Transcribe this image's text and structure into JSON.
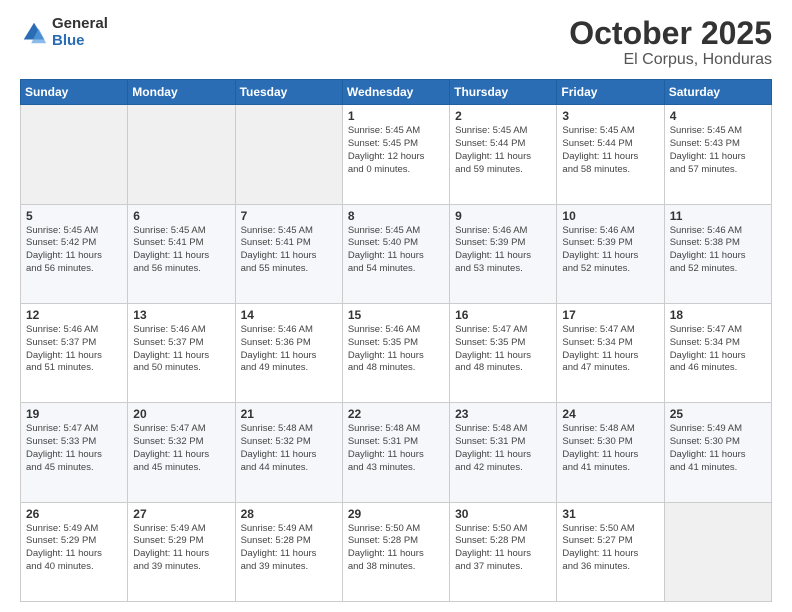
{
  "logo": {
    "general": "General",
    "blue": "Blue"
  },
  "title": "October 2025",
  "subtitle": "El Corpus, Honduras",
  "days_header": [
    "Sunday",
    "Monday",
    "Tuesday",
    "Wednesday",
    "Thursday",
    "Friday",
    "Saturday"
  ],
  "weeks": [
    [
      {
        "day": "",
        "info": ""
      },
      {
        "day": "",
        "info": ""
      },
      {
        "day": "",
        "info": ""
      },
      {
        "day": "1",
        "info": "Sunrise: 5:45 AM\nSunset: 5:45 PM\nDaylight: 12 hours\nand 0 minutes."
      },
      {
        "day": "2",
        "info": "Sunrise: 5:45 AM\nSunset: 5:44 PM\nDaylight: 11 hours\nand 59 minutes."
      },
      {
        "day": "3",
        "info": "Sunrise: 5:45 AM\nSunset: 5:44 PM\nDaylight: 11 hours\nand 58 minutes."
      },
      {
        "day": "4",
        "info": "Sunrise: 5:45 AM\nSunset: 5:43 PM\nDaylight: 11 hours\nand 57 minutes."
      }
    ],
    [
      {
        "day": "5",
        "info": "Sunrise: 5:45 AM\nSunset: 5:42 PM\nDaylight: 11 hours\nand 56 minutes."
      },
      {
        "day": "6",
        "info": "Sunrise: 5:45 AM\nSunset: 5:41 PM\nDaylight: 11 hours\nand 56 minutes."
      },
      {
        "day": "7",
        "info": "Sunrise: 5:45 AM\nSunset: 5:41 PM\nDaylight: 11 hours\nand 55 minutes."
      },
      {
        "day": "8",
        "info": "Sunrise: 5:45 AM\nSunset: 5:40 PM\nDaylight: 11 hours\nand 54 minutes."
      },
      {
        "day": "9",
        "info": "Sunrise: 5:46 AM\nSunset: 5:39 PM\nDaylight: 11 hours\nand 53 minutes."
      },
      {
        "day": "10",
        "info": "Sunrise: 5:46 AM\nSunset: 5:39 PM\nDaylight: 11 hours\nand 52 minutes."
      },
      {
        "day": "11",
        "info": "Sunrise: 5:46 AM\nSunset: 5:38 PM\nDaylight: 11 hours\nand 52 minutes."
      }
    ],
    [
      {
        "day": "12",
        "info": "Sunrise: 5:46 AM\nSunset: 5:37 PM\nDaylight: 11 hours\nand 51 minutes."
      },
      {
        "day": "13",
        "info": "Sunrise: 5:46 AM\nSunset: 5:37 PM\nDaylight: 11 hours\nand 50 minutes."
      },
      {
        "day": "14",
        "info": "Sunrise: 5:46 AM\nSunset: 5:36 PM\nDaylight: 11 hours\nand 49 minutes."
      },
      {
        "day": "15",
        "info": "Sunrise: 5:46 AM\nSunset: 5:35 PM\nDaylight: 11 hours\nand 48 minutes."
      },
      {
        "day": "16",
        "info": "Sunrise: 5:47 AM\nSunset: 5:35 PM\nDaylight: 11 hours\nand 48 minutes."
      },
      {
        "day": "17",
        "info": "Sunrise: 5:47 AM\nSunset: 5:34 PM\nDaylight: 11 hours\nand 47 minutes."
      },
      {
        "day": "18",
        "info": "Sunrise: 5:47 AM\nSunset: 5:34 PM\nDaylight: 11 hours\nand 46 minutes."
      }
    ],
    [
      {
        "day": "19",
        "info": "Sunrise: 5:47 AM\nSunset: 5:33 PM\nDaylight: 11 hours\nand 45 minutes."
      },
      {
        "day": "20",
        "info": "Sunrise: 5:47 AM\nSunset: 5:32 PM\nDaylight: 11 hours\nand 45 minutes."
      },
      {
        "day": "21",
        "info": "Sunrise: 5:48 AM\nSunset: 5:32 PM\nDaylight: 11 hours\nand 44 minutes."
      },
      {
        "day": "22",
        "info": "Sunrise: 5:48 AM\nSunset: 5:31 PM\nDaylight: 11 hours\nand 43 minutes."
      },
      {
        "day": "23",
        "info": "Sunrise: 5:48 AM\nSunset: 5:31 PM\nDaylight: 11 hours\nand 42 minutes."
      },
      {
        "day": "24",
        "info": "Sunrise: 5:48 AM\nSunset: 5:30 PM\nDaylight: 11 hours\nand 41 minutes."
      },
      {
        "day": "25",
        "info": "Sunrise: 5:49 AM\nSunset: 5:30 PM\nDaylight: 11 hours\nand 41 minutes."
      }
    ],
    [
      {
        "day": "26",
        "info": "Sunrise: 5:49 AM\nSunset: 5:29 PM\nDaylight: 11 hours\nand 40 minutes."
      },
      {
        "day": "27",
        "info": "Sunrise: 5:49 AM\nSunset: 5:29 PM\nDaylight: 11 hours\nand 39 minutes."
      },
      {
        "day": "28",
        "info": "Sunrise: 5:49 AM\nSunset: 5:28 PM\nDaylight: 11 hours\nand 39 minutes."
      },
      {
        "day": "29",
        "info": "Sunrise: 5:50 AM\nSunset: 5:28 PM\nDaylight: 11 hours\nand 38 minutes."
      },
      {
        "day": "30",
        "info": "Sunrise: 5:50 AM\nSunset: 5:28 PM\nDaylight: 11 hours\nand 37 minutes."
      },
      {
        "day": "31",
        "info": "Sunrise: 5:50 AM\nSunset: 5:27 PM\nDaylight: 11 hours\nand 36 minutes."
      },
      {
        "day": "",
        "info": ""
      }
    ]
  ]
}
